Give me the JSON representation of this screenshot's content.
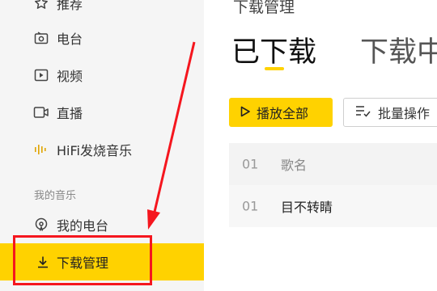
{
  "sidebar": {
    "items": [
      {
        "label": "推荐",
        "icon": "star-icon"
      },
      {
        "label": "电台",
        "icon": "radio-icon"
      },
      {
        "label": "视频",
        "icon": "video-icon"
      },
      {
        "label": "直播",
        "icon": "live-camera-icon"
      },
      {
        "label": "HiFi发烧音乐",
        "icon": "hifi-wave-icon"
      }
    ],
    "section_label": "我的音乐",
    "my_music_items": [
      {
        "label": "我的电台",
        "icon": "podcast-icon"
      },
      {
        "label": "下载管理",
        "icon": "download-icon",
        "active": true
      }
    ]
  },
  "main": {
    "page_title": "下载管理",
    "tabs": [
      {
        "label": "已下载",
        "active": true
      },
      {
        "label": "下载中",
        "active": false
      }
    ],
    "toolbar": {
      "play_all_label": "播放全部",
      "batch_label": "批量操作"
    },
    "table": {
      "header": {
        "num": "01",
        "title": "歌名"
      },
      "rows": [
        {
          "num": "01",
          "title": "目不转睛"
        }
      ]
    }
  },
  "colors": {
    "accent": "#ffd200",
    "annotation_red": "#f5161e",
    "sidebar_bg": "#f5f5f5"
  }
}
